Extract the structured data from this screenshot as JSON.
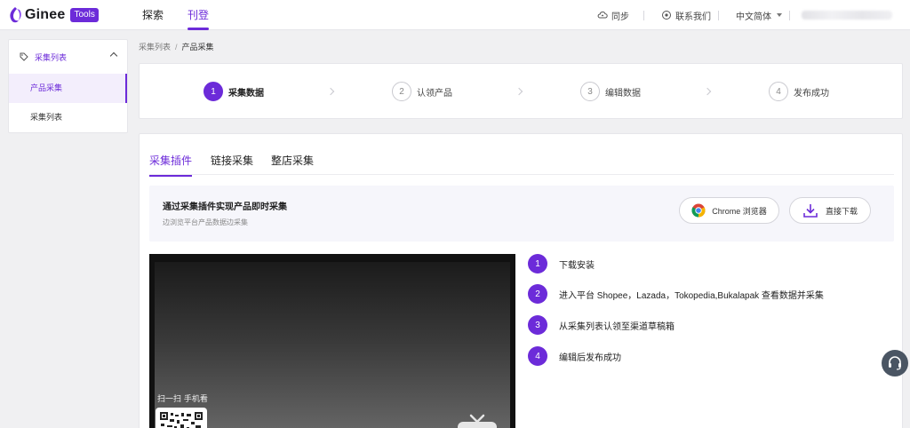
{
  "brand": {
    "name": "Ginee",
    "badge": "Tools"
  },
  "nav": {
    "items": [
      {
        "label": "探索"
      },
      {
        "label": "刊登"
      }
    ],
    "active": 1
  },
  "topbar": {
    "sync": "同步",
    "contact": "联系我们",
    "language": "中文简体"
  },
  "sidebar": {
    "group_label": "采集列表",
    "items": [
      {
        "label": "产品采集",
        "active": true
      },
      {
        "label": "采集列表",
        "active": false
      }
    ]
  },
  "breadcrumb": {
    "parent": "采集列表",
    "separator": "/",
    "current": "产品采集"
  },
  "steps": [
    {
      "num": "1",
      "label": "采集数据",
      "active": true
    },
    {
      "num": "2",
      "label": "认领产品",
      "active": false
    },
    {
      "num": "3",
      "label": "编辑数据",
      "active": false
    },
    {
      "num": "4",
      "label": "发布成功",
      "active": false
    }
  ],
  "tabs": [
    {
      "label": "采集插件"
    },
    {
      "label": "链接采集"
    },
    {
      "label": "整店采集"
    }
  ],
  "active_tab": 0,
  "plugin": {
    "title": "通过采集插件实现产品即时采集",
    "subtitle": "边浏览平台产品数据边采集",
    "chrome_button": "Chrome 浏览器",
    "download_button": "直接下载"
  },
  "video": {
    "scan_text": "扫一扫 手机看"
  },
  "guide": [
    {
      "num": "1",
      "text": "下载安装"
    },
    {
      "num": "2",
      "text": "进入平台 Shopee，Lazada，Tokopedia,Bukalapak 查看数据并采集"
    },
    {
      "num": "3",
      "text": "从采集列表认领至渠道草稿箱"
    },
    {
      "num": "4",
      "text": "编辑后发布成功"
    }
  ],
  "colors": {
    "accent": "#6c2bd9",
    "fab": "#4a5563"
  }
}
